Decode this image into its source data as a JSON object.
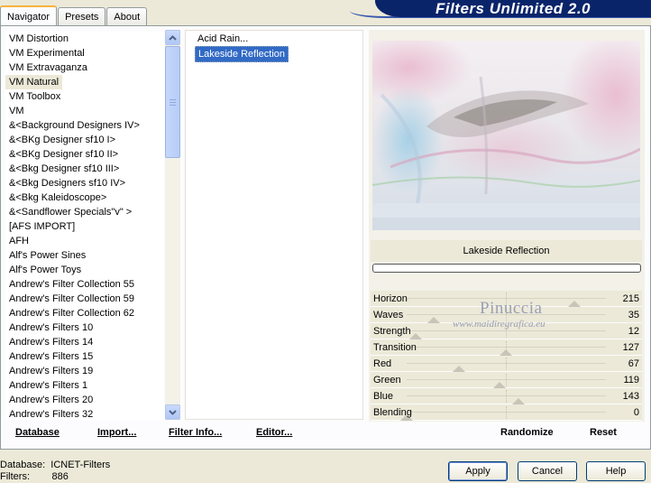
{
  "tabs": [
    {
      "label": "Navigator",
      "active": true
    },
    {
      "label": "Presets",
      "active": false
    },
    {
      "label": "About",
      "active": false
    }
  ],
  "banner_title": "Filters Unlimited 2.0",
  "categories": [
    "VM Distortion",
    "VM Experimental",
    "VM Extravaganza",
    "VM Natural",
    "VM Toolbox",
    "VM",
    "&<Background Designers IV>",
    "&<BKg Designer sf10 I>",
    "&<BKg Designer sf10 II>",
    "&<Bkg Designer sf10 III>",
    "&<Bkg Designers sf10 IV>",
    "&<Bkg Kaleidoscope>",
    "&<Sandflower Specials\"v\" >",
    "[AFS IMPORT]",
    "AFH",
    "Alf's Power Sines",
    "Alf's Power Toys",
    "Andrew's Filter Collection 55",
    "Andrew's Filter Collection 59",
    "Andrew's Filter Collection 62",
    "Andrew's Filters 10",
    "Andrew's Filters 14",
    "Andrew's Filters 15",
    "Andrew's Filters 19",
    "Andrew's Filters 1",
    "Andrew's Filters 20",
    "Andrew's Filters 32"
  ],
  "selected_category": "VM Natural",
  "filters": [
    "Acid Rain...",
    "Lakeside Reflection"
  ],
  "selected_filter": "Lakeside Reflection",
  "filter_name": "Lakeside Reflection",
  "params": [
    {
      "label": "Horizon",
      "value": "215",
      "level": 0.843
    },
    {
      "label": "Waves",
      "value": "35",
      "level": 0.137
    },
    {
      "label": "Strength",
      "value": "12",
      "level": 0.047
    },
    {
      "label": "Transition",
      "value": "127",
      "level": 0.498
    },
    {
      "label": "Red",
      "value": "67",
      "level": 0.263
    },
    {
      "label": "Green",
      "value": "119",
      "level": 0.467
    },
    {
      "label": "Blue",
      "value": "143",
      "level": 0.561
    },
    {
      "label": "Blending",
      "value": "0",
      "level": 0.0
    }
  ],
  "watermark": {
    "name": "Pinuccia",
    "site": "www.maidiregrafica.eu"
  },
  "buttons": {
    "database": "Database",
    "import": "Import...",
    "filter_info": "Filter Info...",
    "editor": "Editor...",
    "randomize": "Randomize",
    "reset": "Reset",
    "apply": "Apply",
    "cancel": "Cancel",
    "help": "Help"
  },
  "status": {
    "database_label": "Database:",
    "database_value": "ICNET-Filters",
    "filters_label": "Filters:",
    "filters_value": "886"
  },
  "colors": {
    "banner": "#0a246a",
    "selection": "#316ac5",
    "panel": "#ece9d8"
  }
}
